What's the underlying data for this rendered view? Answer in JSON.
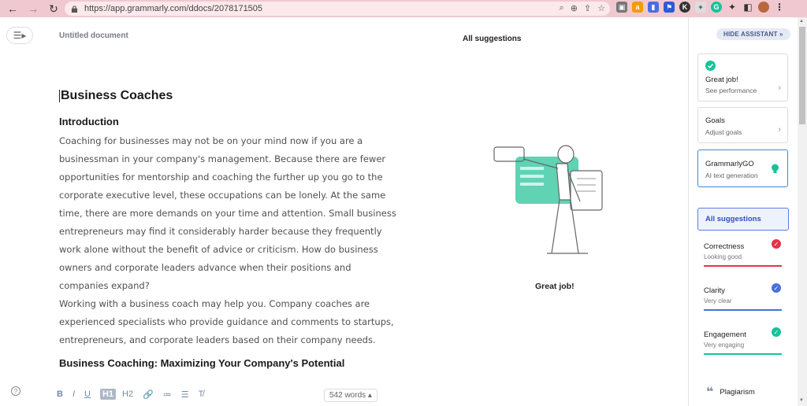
{
  "browser": {
    "url": "https://app.grammarly.com/ddocs/2078171505"
  },
  "header": {
    "doc_title": "Untitled document",
    "suggestions_title": "All suggestions"
  },
  "document": {
    "heading": "Business Coaches",
    "section1_title": "Introduction",
    "lines1": [
      "Coaching for businesses may not be on your mind now if you are a",
      "businessman in your company's management. Because there are fewer",
      "opportunities for mentorship and coaching the further up you go to the",
      "corporate executive level, these occupations can be lonely. At the same",
      "time, there are more demands on your time and attention. Small business",
      "entrepreneurs may find it considerably harder because they frequently",
      "work alone without the benefit of advice or criticism. How do business",
      "owners and corporate leaders advance when their positions and",
      "companies expand?",
      "Working with a business coach may help you. Company coaches are",
      "experienced specialists who provide guidance and comments to startups,",
      "entrepreneurs, and corporate leaders based on their company needs."
    ],
    "section2_title": "Business Coaching: Maximizing Your Company's Potential"
  },
  "panel": {
    "great_job": "Great job!"
  },
  "toolbar": {
    "bold": "B",
    "italic": "I",
    "underline": "U",
    "h1": "H1",
    "h2": "H2",
    "word_count": "542 words"
  },
  "sidebar": {
    "hide_label": "HIDE ASSISTANT",
    "cards": [
      {
        "title": "Great job!",
        "sub": "See performance"
      },
      {
        "title": "Goals",
        "sub": "Adjust goals"
      },
      {
        "title": "GrammarlyGO",
        "sub": "AI text generation"
      }
    ],
    "all_suggestions": "All suggestions",
    "categories": [
      {
        "title": "Correctness",
        "sub": "Looking good",
        "color": "#e5334b"
      },
      {
        "title": "Clarity",
        "sub": "Very clear",
        "color": "#4a6ee0"
      },
      {
        "title": "Engagement",
        "sub": "Very engaging",
        "color": "#15c39a"
      }
    ],
    "plagiarism": "Plagiarism"
  }
}
